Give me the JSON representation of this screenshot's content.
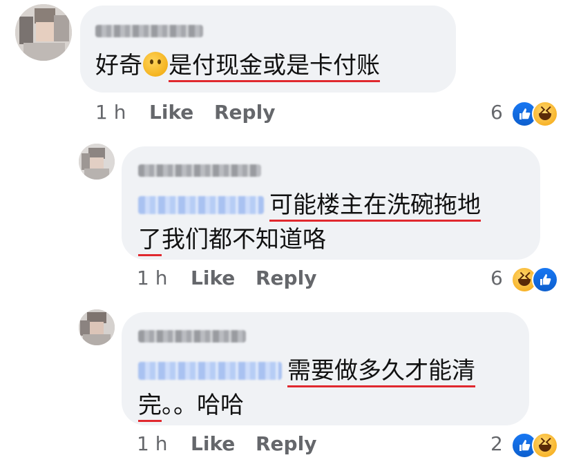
{
  "comments": [
    {
      "name_hidden": true,
      "text_parts": [
        "好奇",
        "是付现金或是卡付账"
      ],
      "time": "1 h",
      "like_label": "Like",
      "reply_label": "Reply",
      "reaction_count": "6",
      "reactions": [
        "like-icon",
        "haha-icon"
      ]
    },
    {
      "name_hidden": true,
      "mention_hidden": true,
      "text_line1": "可能楼主在洗碗拖地",
      "text_line2_underlined": "了",
      "text_line2_rest": "我们都不知道咯",
      "time": "1 h",
      "like_label": "Like",
      "reply_label": "Reply",
      "reaction_count": "6",
      "reactions": [
        "haha-icon",
        "like-icon"
      ]
    },
    {
      "name_hidden": true,
      "mention_hidden": true,
      "text_line1": "需要做多久才能清",
      "text_line2_underlined": "完",
      "text_line2_rest": "。。哈哈",
      "time": "1 h",
      "like_label": "Like",
      "reply_label": "Reply",
      "reaction_count": "2",
      "reactions": [
        "like-icon",
        "haha-icon"
      ]
    }
  ],
  "colors": {
    "bubble": "#f0f2f5",
    "meta_text": "#65676b",
    "underline": "#e0282e",
    "like_blue": "#1877f2",
    "haha_yellow": "#f7b125",
    "mention_blur": "#b6cdf5"
  }
}
